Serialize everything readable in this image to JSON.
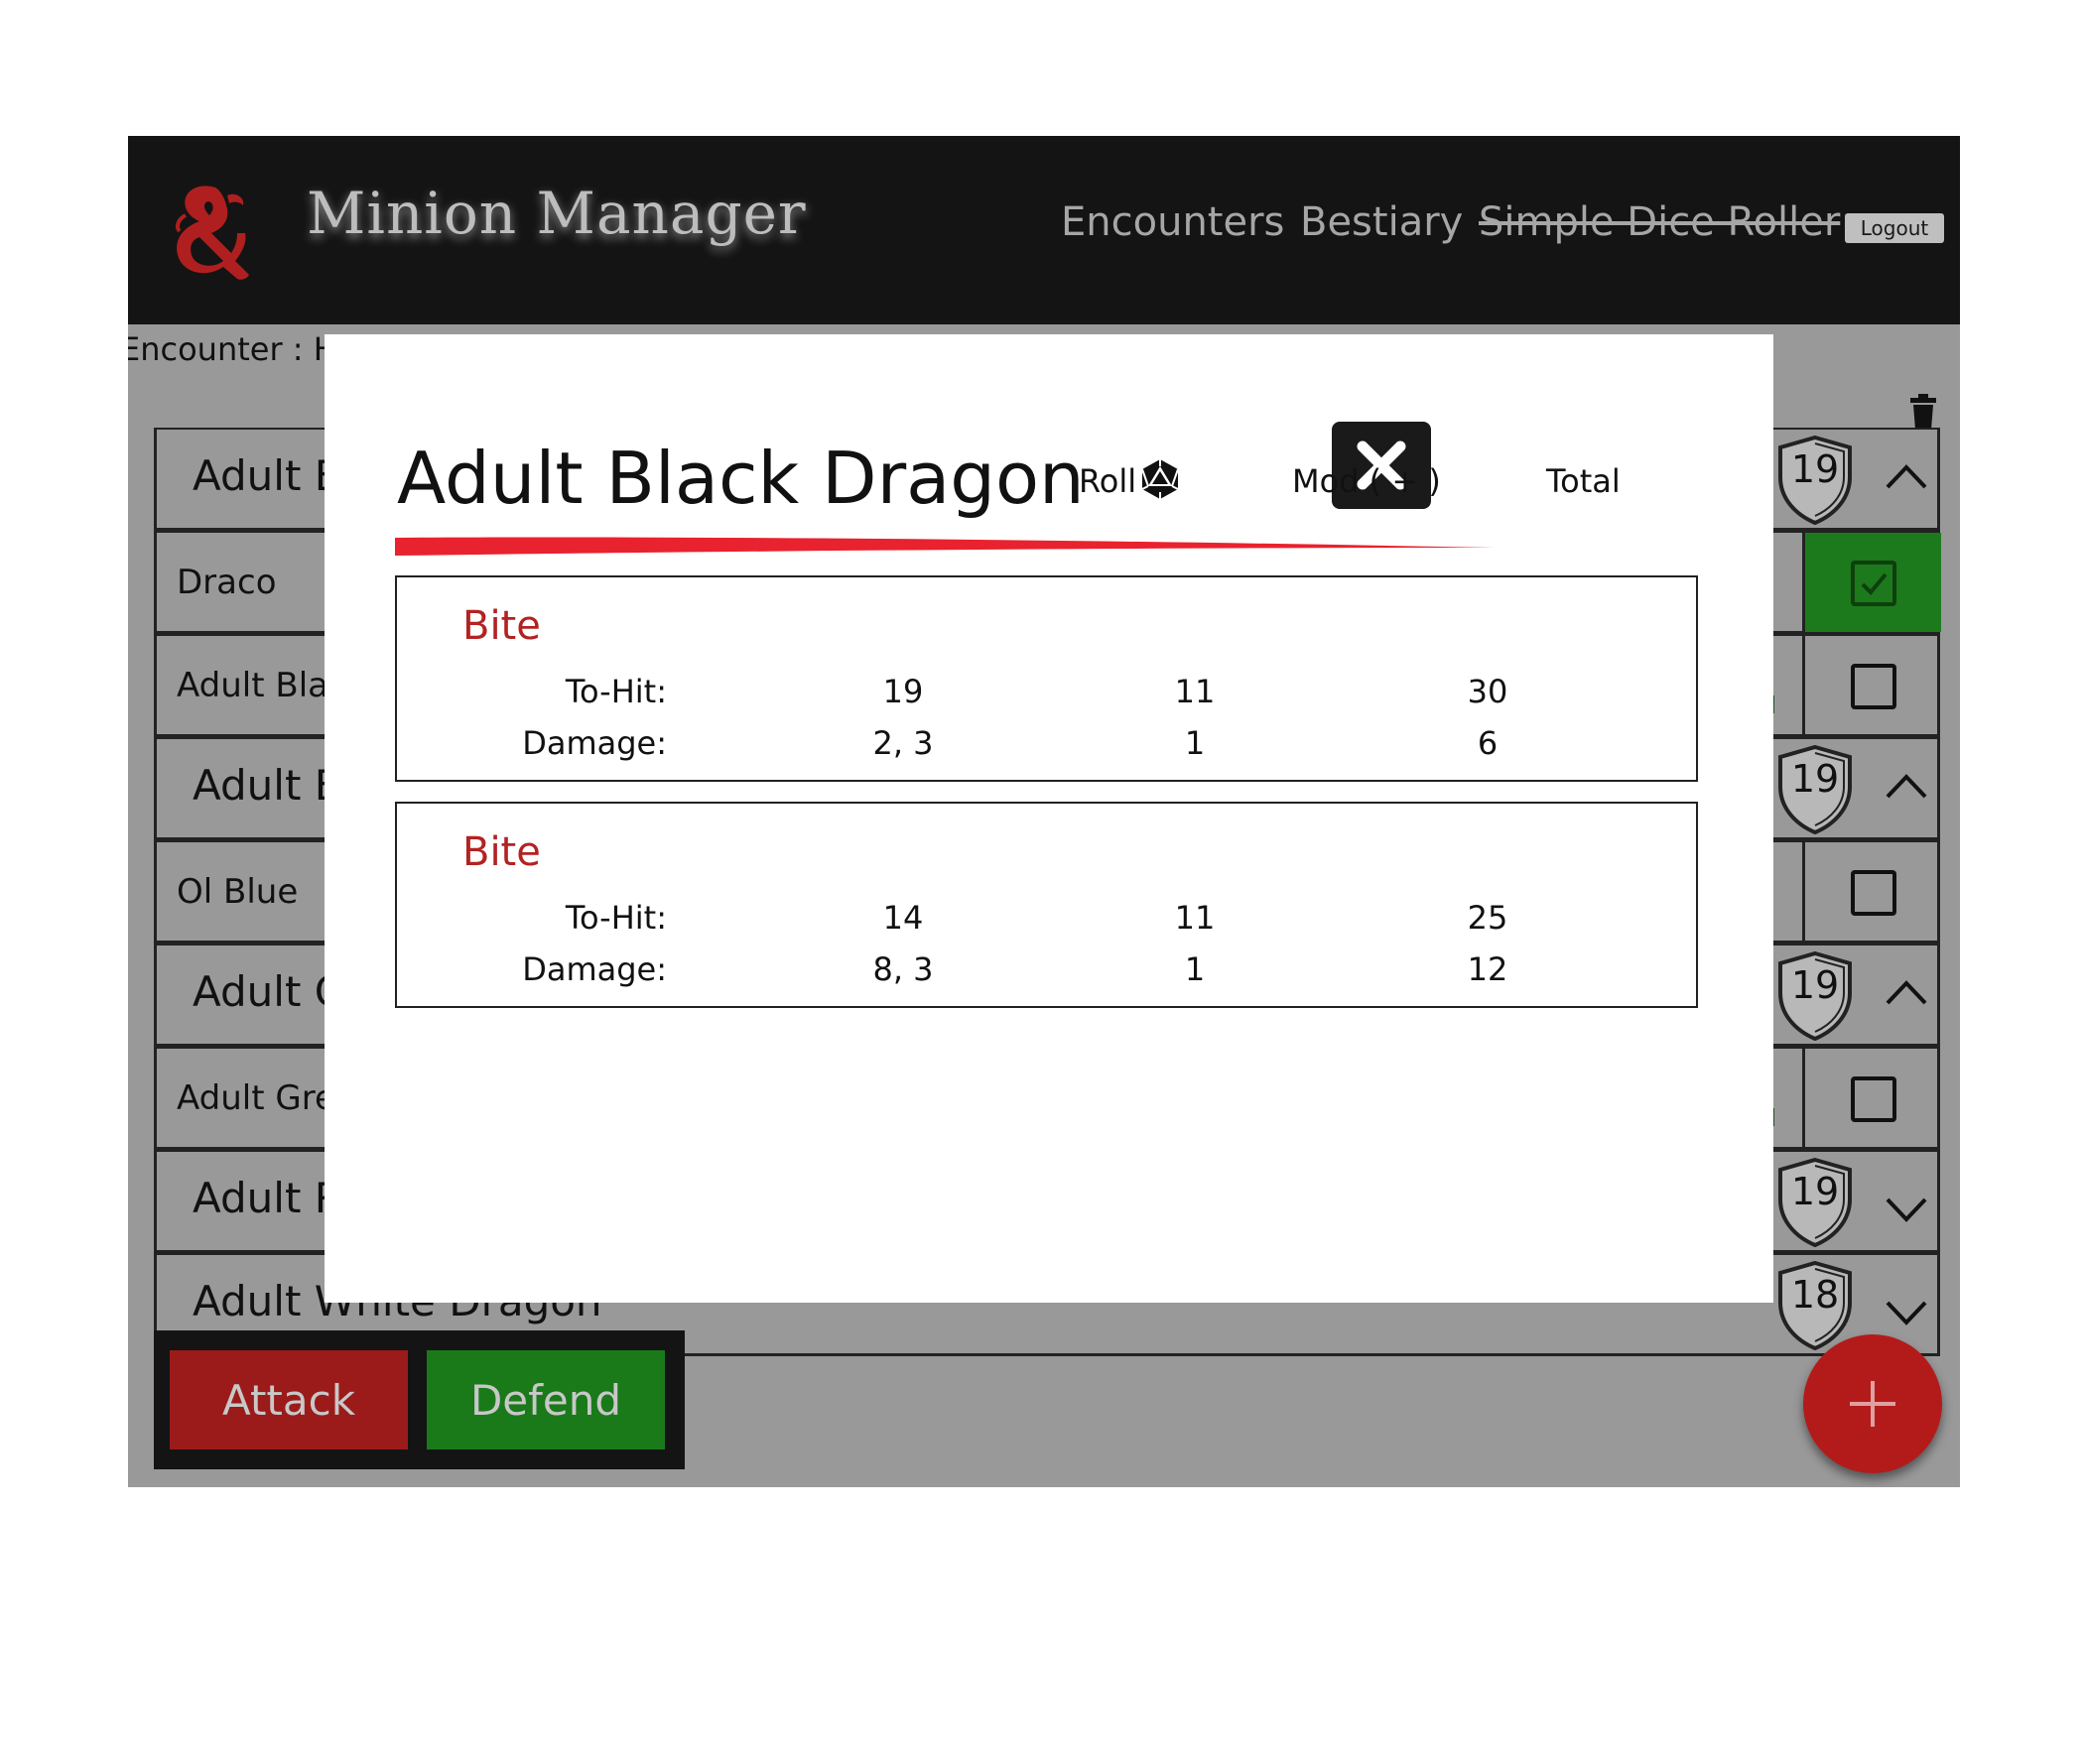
{
  "app": {
    "title": "Minion Manager",
    "nav": {
      "encounters": "Encounters",
      "bestiary": "Bestiary",
      "dice_roller": "Simple Dice Roller",
      "logout": "Logout"
    },
    "encounter_label": "Encounter : He"
  },
  "list": {
    "rows": [
      {
        "label": "Adult B",
        "type": "group",
        "initiative": "19",
        "chevron": "up"
      },
      {
        "label": "Draco",
        "type": "member",
        "checked": true
      },
      {
        "label": "Adult Blac",
        "type": "member",
        "checked": false
      },
      {
        "label": "Adult B",
        "type": "group",
        "initiative": "19",
        "chevron": "up"
      },
      {
        "label": "Ol Blue",
        "type": "member",
        "checked": false
      },
      {
        "label": "Adult G",
        "type": "group",
        "initiative": "19",
        "chevron": "up"
      },
      {
        "label": "Adult Gree",
        "type": "member",
        "checked": false
      },
      {
        "label": "Adult R",
        "type": "group",
        "initiative": "19",
        "chevron": "down"
      },
      {
        "label": "Adult White Dragon",
        "type": "group",
        "initiative": "18",
        "chevron": "down"
      }
    ]
  },
  "actions": {
    "attack": "Attack",
    "defend": "Defend"
  },
  "modal": {
    "title": "Adult Black Dragon",
    "columns": {
      "roll": "Roll",
      "mod": "Mod ( + )",
      "total": "Total"
    },
    "attacks": [
      {
        "name": "Bite",
        "to_hit": {
          "label": "To-Hit:",
          "roll": "19",
          "mod": "11",
          "total": "30"
        },
        "damage": {
          "label": "Damage:",
          "roll": "2, 3",
          "mod": "1",
          "total": "6"
        }
      },
      {
        "name": "Bite",
        "to_hit": {
          "label": "To-Hit:",
          "roll": "14",
          "mod": "11",
          "total": "25"
        },
        "damage": {
          "label": "Damage:",
          "roll": "8, 3",
          "mod": "1",
          "total": "12"
        }
      }
    ]
  },
  "colors": {
    "topbar": "#141414",
    "backdrop": "#999999",
    "accent_red": "#b32222",
    "attack_red": "#9b1b1b",
    "defend_green": "#1a7a1a",
    "check_green": "#1c7a1c"
  },
  "icons": {
    "logo": "dnd-ampersand-dragon-logo",
    "trash": "trash-icon",
    "close": "close-icon",
    "roll": "d20-icon",
    "add": "plus-icon",
    "shield": "shield-icon",
    "edit": "quill-icon"
  }
}
